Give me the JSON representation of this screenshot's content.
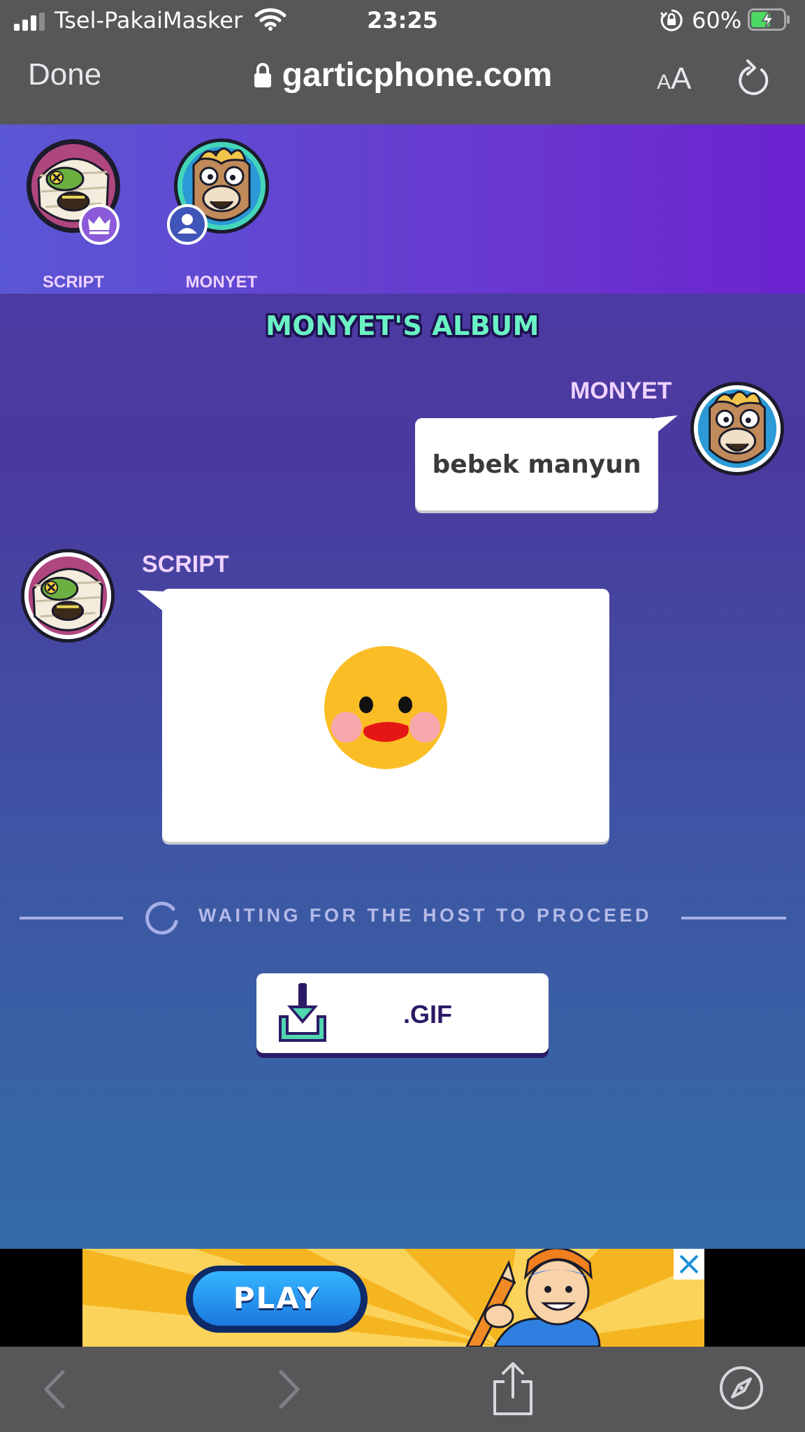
{
  "status_bar": {
    "carrier": "Tsel-PakaiMasker",
    "time": "23:25",
    "battery_percent": "60%",
    "battery_level": 0.6
  },
  "browser": {
    "done_label": "Done",
    "url": "garticphone.com",
    "text_size_label_small": "A",
    "text_size_label_large": "A"
  },
  "players": [
    {
      "name": "SCRIPT",
      "badge": "crown-icon"
    },
    {
      "name": "MONYET",
      "badge": "user-icon"
    }
  ],
  "album": {
    "title": "MONYET'S ALBUM",
    "entries": [
      {
        "author": "MONYET",
        "type": "text",
        "text": "bebek manyun"
      },
      {
        "author": "SCRIPT",
        "type": "drawing"
      }
    ]
  },
  "waiting": {
    "text": "WAITING FOR THE HOST TO PROCEED"
  },
  "download": {
    "label": ".GIF",
    "icon": "download-icon"
  },
  "ad": {
    "play_label": "PLAY"
  },
  "colors": {
    "accent_green": "#6af2c4",
    "name_pink": "#efd2ff",
    "button_navy": "#2c1a66"
  }
}
